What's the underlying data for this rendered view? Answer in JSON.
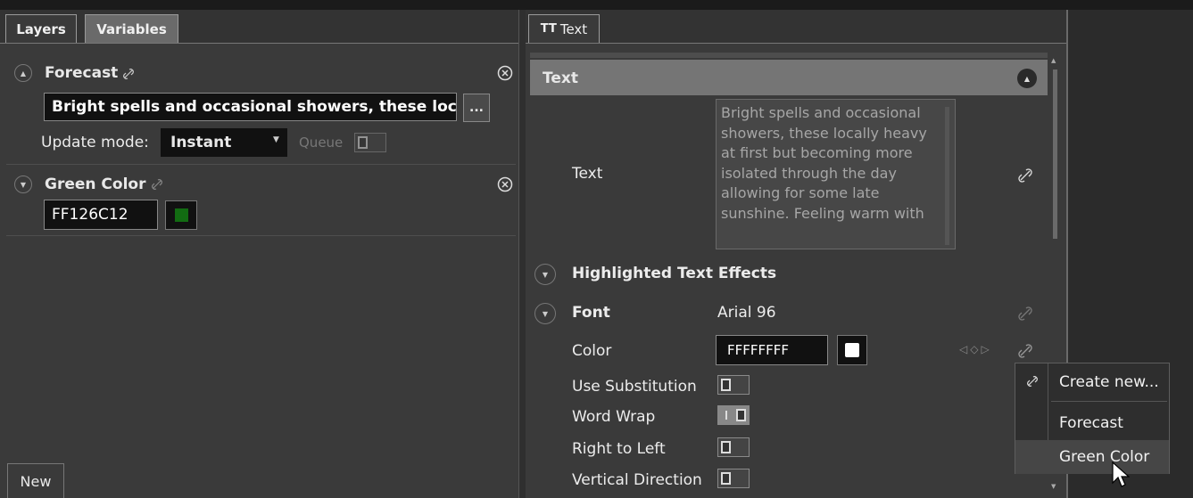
{
  "left_panel": {
    "tabs": [
      {
        "label": "Layers"
      },
      {
        "label": "Variables"
      }
    ],
    "variables": [
      {
        "name": "Forecast",
        "value": "Bright spells and occasional showers, these locally",
        "browse_label": "...",
        "update_mode_label": "Update mode:",
        "update_mode_value": "Instant",
        "queue_label": "Queue"
      },
      {
        "name": "Green Color",
        "value": "FF126C12",
        "swatch_color": "#126C12"
      }
    ],
    "new_button": "New"
  },
  "right_panel": {
    "tab_label": "Text",
    "tab_icon_label": "TT",
    "section_title": "Text",
    "text_property_label": "Text",
    "text_value_lines": [
      "Bright spells and occasional",
      "showers, these locally heavy",
      "at first but becoming more",
      "isolated through the day",
      "allowing for some late",
      "sunshine. Feeling warm with"
    ],
    "highlighted_effects_label": "Highlighted Text Effects",
    "font_label": "Font",
    "font_value": "Arial 96",
    "color_label": "Color",
    "color_value": "FFFFFFFF",
    "color_swatch": "#FFFFFF",
    "toggles": [
      {
        "label": "Use Substitution",
        "on": false
      },
      {
        "label": "Word Wrap",
        "on": true
      },
      {
        "label": "Right to Left",
        "on": false
      },
      {
        "label": "Vertical Direction",
        "on": false
      }
    ]
  },
  "link_menu": {
    "items": [
      {
        "label": "Create new..."
      },
      {
        "label": "Forecast"
      },
      {
        "label": "Green Color"
      }
    ]
  }
}
